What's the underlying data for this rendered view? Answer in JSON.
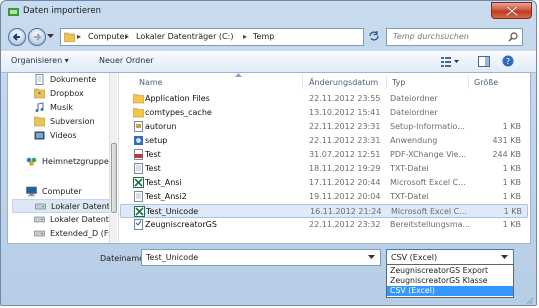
{
  "window": {
    "title": "Daten importieren"
  },
  "address": {
    "crumbs": [
      "Computer",
      "Lokaler Datenträger (C:)",
      "Temp"
    ],
    "search_placeholder": "Temp durchsuchen"
  },
  "toolbar": {
    "organize_label": "Organisieren",
    "new_folder_label": "Neuer Ordner"
  },
  "sidebar": {
    "items": [
      {
        "label": "Dokumente",
        "icon": "documents-icon"
      },
      {
        "label": "Dropbox",
        "icon": "dropbox-icon"
      },
      {
        "label": "Musik",
        "icon": "music-icon"
      },
      {
        "label": "Subversion",
        "icon": "subversion-icon"
      },
      {
        "label": "Videos",
        "icon": "videos-icon"
      },
      {
        "label": "Heimnetzgruppe",
        "icon": "homegroup-icon"
      },
      {
        "label": "Computer",
        "icon": "computer-icon"
      },
      {
        "label": "Lokaler Datenträ",
        "icon": "drive-icon"
      },
      {
        "label": "Lokaler Datenträ",
        "icon": "drive-icon"
      },
      {
        "label": "Extended_D (F:)",
        "icon": "drive-icon"
      }
    ]
  },
  "columns": {
    "name": "Name",
    "date": "Änderungsdatum",
    "type": "Typ",
    "size": "Größe"
  },
  "files": [
    {
      "name": "Application Files",
      "date": "22.11.2012 23:55",
      "type": "Dateiordner",
      "size": "",
      "icon": "folder-icon"
    },
    {
      "name": "comtypes_cache",
      "date": "13.10.2012 15:41",
      "type": "Dateiordner",
      "size": "",
      "icon": "folder-icon"
    },
    {
      "name": "autorun",
      "date": "22.11.2012 23:31",
      "type": "Setup-Informatio...",
      "size": "1 KB",
      "icon": "setup-info-icon"
    },
    {
      "name": "setup",
      "date": "22.11.2012 23:31",
      "type": "Anwendung",
      "size": "431 KB",
      "icon": "setup-app-icon"
    },
    {
      "name": "Test",
      "date": "31.07.2012 12:51",
      "type": "PDF-XChange Vie...",
      "size": "244 KB",
      "icon": "pdf-icon"
    },
    {
      "name": "Test",
      "date": "18.11.2012 19:29",
      "type": "TXT-Datei",
      "size": "1 KB",
      "icon": "text-file-icon"
    },
    {
      "name": "Test_Ansi",
      "date": "17.11.2012 20:44",
      "type": "Microsoft Excel C...",
      "size": "1 KB",
      "icon": "excel-icon"
    },
    {
      "name": "Test_Ansi2",
      "date": "19.11.2012 20:04",
      "type": "TXT-Datei",
      "size": "1 KB",
      "icon": "text-file-icon"
    },
    {
      "name": "Test_Unicode",
      "date": "16.11.2012 21:24",
      "type": "Microsoft Excel C...",
      "size": "1 KB",
      "icon": "excel-icon",
      "selected": true
    },
    {
      "name": "ZeugniscreatorGS",
      "date": "22.11.2012 23:32",
      "type": "Bereitstellungsma...",
      "size": "1 KB",
      "icon": "manifest-icon"
    }
  ],
  "footer": {
    "filename_label": "Dateiname:",
    "filename_value": "Test_Unicode",
    "filetype_value": "CSV (Excel)",
    "filetype_options": [
      "ZeugniscreatorGS Export",
      "ZeugniscreatorGS Klasse",
      "CSV (Excel)"
    ],
    "filetype_selected_index": 2
  },
  "colors": {
    "selection": "#3399ff",
    "folder": "#f2c74a",
    "excel": "#1e7145",
    "pdf": "#c0392b"
  }
}
